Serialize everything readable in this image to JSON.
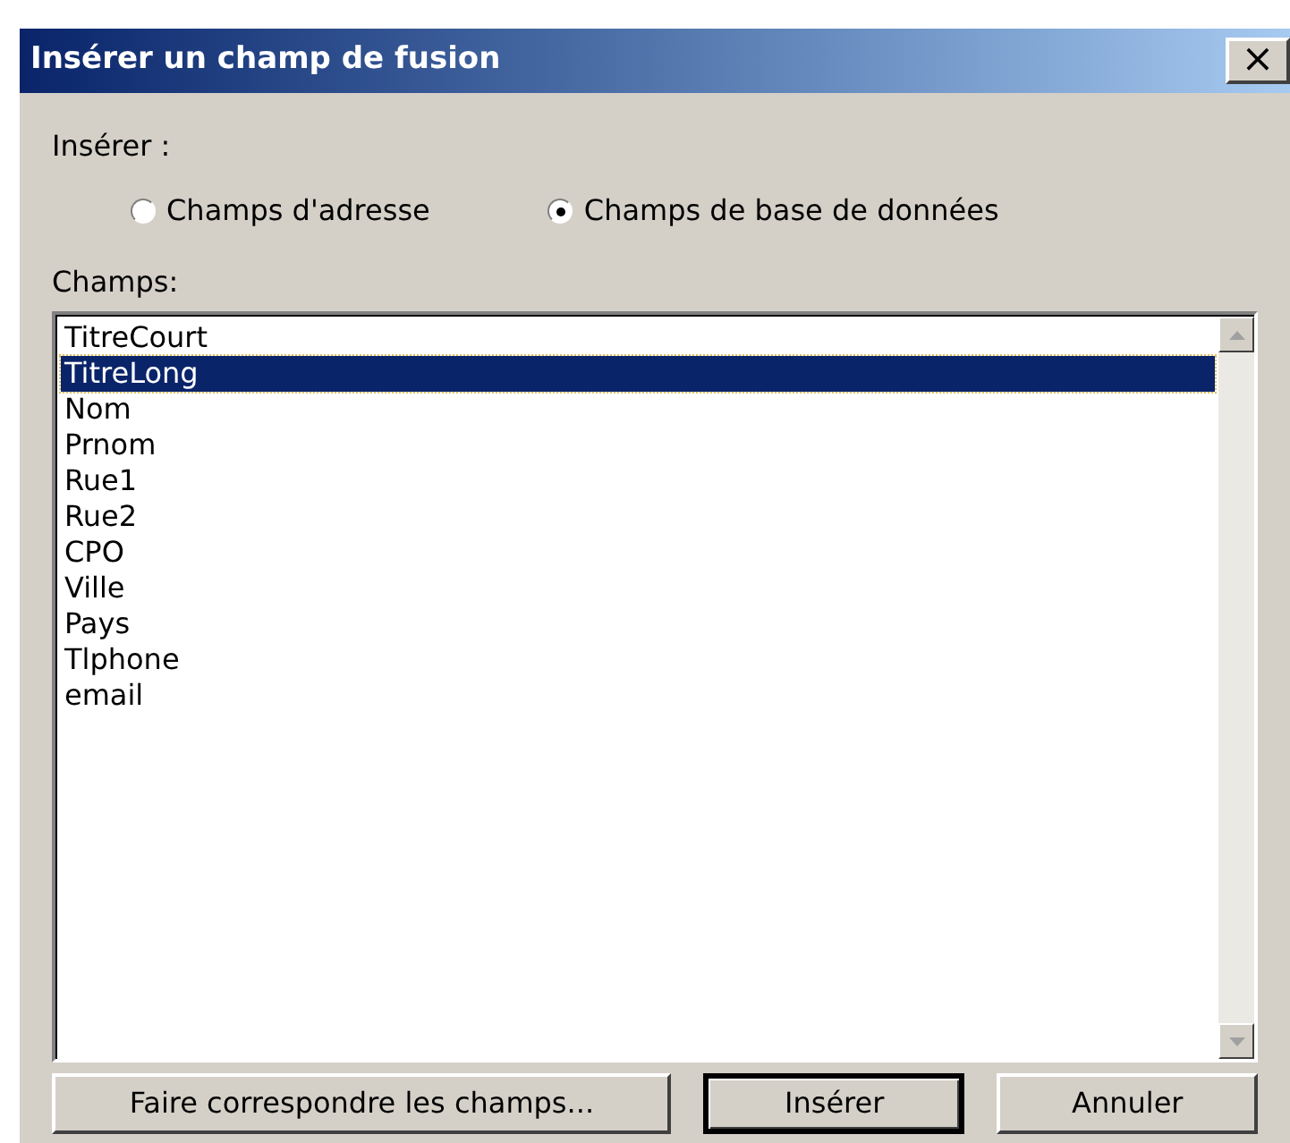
{
  "window": {
    "title": "Insérer un champ de fusion",
    "close": "×"
  },
  "insert_group": {
    "label": "Insérer :",
    "options": [
      {
        "label": "Champs d'adresse",
        "selected": false
      },
      {
        "label": "Champs de base de données",
        "selected": true
      }
    ]
  },
  "fields_label": "Champs:",
  "fields": [
    {
      "label": "TitreCourt",
      "selected": false
    },
    {
      "label": "TitreLong",
      "selected": true
    },
    {
      "label": "Nom",
      "selected": false
    },
    {
      "label": "Prnom",
      "selected": false
    },
    {
      "label": "Rue1",
      "selected": false
    },
    {
      "label": "Rue2",
      "selected": false
    },
    {
      "label": "CPO",
      "selected": false
    },
    {
      "label": "Ville",
      "selected": false
    },
    {
      "label": "Pays",
      "selected": false
    },
    {
      "label": "Tlphone",
      "selected": false
    },
    {
      "label": "email",
      "selected": false
    }
  ],
  "buttons": [
    {
      "label": "Faire correspondre les champs...",
      "default": false
    },
    {
      "label": "Insérer",
      "default": true
    },
    {
      "label": "Annuler",
      "default": false
    }
  ]
}
